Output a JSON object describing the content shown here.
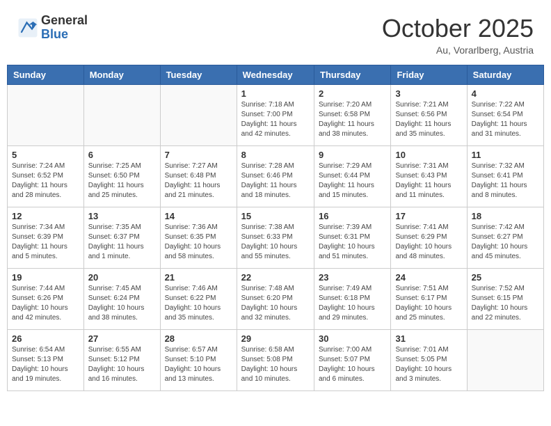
{
  "logo": {
    "general": "General",
    "blue": "Blue"
  },
  "title": {
    "month_year": "October 2025",
    "location": "Au, Vorarlberg, Austria"
  },
  "headers": [
    "Sunday",
    "Monday",
    "Tuesday",
    "Wednesday",
    "Thursday",
    "Friday",
    "Saturday"
  ],
  "weeks": [
    [
      {
        "day": "",
        "info": ""
      },
      {
        "day": "",
        "info": ""
      },
      {
        "day": "",
        "info": ""
      },
      {
        "day": "1",
        "info": "Sunrise: 7:18 AM\nSunset: 7:00 PM\nDaylight: 11 hours and 42 minutes."
      },
      {
        "day": "2",
        "info": "Sunrise: 7:20 AM\nSunset: 6:58 PM\nDaylight: 11 hours and 38 minutes."
      },
      {
        "day": "3",
        "info": "Sunrise: 7:21 AM\nSunset: 6:56 PM\nDaylight: 11 hours and 35 minutes."
      },
      {
        "day": "4",
        "info": "Sunrise: 7:22 AM\nSunset: 6:54 PM\nDaylight: 11 hours and 31 minutes."
      }
    ],
    [
      {
        "day": "5",
        "info": "Sunrise: 7:24 AM\nSunset: 6:52 PM\nDaylight: 11 hours and 28 minutes."
      },
      {
        "day": "6",
        "info": "Sunrise: 7:25 AM\nSunset: 6:50 PM\nDaylight: 11 hours and 25 minutes."
      },
      {
        "day": "7",
        "info": "Sunrise: 7:27 AM\nSunset: 6:48 PM\nDaylight: 11 hours and 21 minutes."
      },
      {
        "day": "8",
        "info": "Sunrise: 7:28 AM\nSunset: 6:46 PM\nDaylight: 11 hours and 18 minutes."
      },
      {
        "day": "9",
        "info": "Sunrise: 7:29 AM\nSunset: 6:44 PM\nDaylight: 11 hours and 15 minutes."
      },
      {
        "day": "10",
        "info": "Sunrise: 7:31 AM\nSunset: 6:43 PM\nDaylight: 11 hours and 11 minutes."
      },
      {
        "day": "11",
        "info": "Sunrise: 7:32 AM\nSunset: 6:41 PM\nDaylight: 11 hours and 8 minutes."
      }
    ],
    [
      {
        "day": "12",
        "info": "Sunrise: 7:34 AM\nSunset: 6:39 PM\nDaylight: 11 hours and 5 minutes."
      },
      {
        "day": "13",
        "info": "Sunrise: 7:35 AM\nSunset: 6:37 PM\nDaylight: 11 hours and 1 minute."
      },
      {
        "day": "14",
        "info": "Sunrise: 7:36 AM\nSunset: 6:35 PM\nDaylight: 10 hours and 58 minutes."
      },
      {
        "day": "15",
        "info": "Sunrise: 7:38 AM\nSunset: 6:33 PM\nDaylight: 10 hours and 55 minutes."
      },
      {
        "day": "16",
        "info": "Sunrise: 7:39 AM\nSunset: 6:31 PM\nDaylight: 10 hours and 51 minutes."
      },
      {
        "day": "17",
        "info": "Sunrise: 7:41 AM\nSunset: 6:29 PM\nDaylight: 10 hours and 48 minutes."
      },
      {
        "day": "18",
        "info": "Sunrise: 7:42 AM\nSunset: 6:27 PM\nDaylight: 10 hours and 45 minutes."
      }
    ],
    [
      {
        "day": "19",
        "info": "Sunrise: 7:44 AM\nSunset: 6:26 PM\nDaylight: 10 hours and 42 minutes."
      },
      {
        "day": "20",
        "info": "Sunrise: 7:45 AM\nSunset: 6:24 PM\nDaylight: 10 hours and 38 minutes."
      },
      {
        "day": "21",
        "info": "Sunrise: 7:46 AM\nSunset: 6:22 PM\nDaylight: 10 hours and 35 minutes."
      },
      {
        "day": "22",
        "info": "Sunrise: 7:48 AM\nSunset: 6:20 PM\nDaylight: 10 hours and 32 minutes."
      },
      {
        "day": "23",
        "info": "Sunrise: 7:49 AM\nSunset: 6:18 PM\nDaylight: 10 hours and 29 minutes."
      },
      {
        "day": "24",
        "info": "Sunrise: 7:51 AM\nSunset: 6:17 PM\nDaylight: 10 hours and 25 minutes."
      },
      {
        "day": "25",
        "info": "Sunrise: 7:52 AM\nSunset: 6:15 PM\nDaylight: 10 hours and 22 minutes."
      }
    ],
    [
      {
        "day": "26",
        "info": "Sunrise: 6:54 AM\nSunset: 5:13 PM\nDaylight: 10 hours and 19 minutes."
      },
      {
        "day": "27",
        "info": "Sunrise: 6:55 AM\nSunset: 5:12 PM\nDaylight: 10 hours and 16 minutes."
      },
      {
        "day": "28",
        "info": "Sunrise: 6:57 AM\nSunset: 5:10 PM\nDaylight: 10 hours and 13 minutes."
      },
      {
        "day": "29",
        "info": "Sunrise: 6:58 AM\nSunset: 5:08 PM\nDaylight: 10 hours and 10 minutes."
      },
      {
        "day": "30",
        "info": "Sunrise: 7:00 AM\nSunset: 5:07 PM\nDaylight: 10 hours and 6 minutes."
      },
      {
        "day": "31",
        "info": "Sunrise: 7:01 AM\nSunset: 5:05 PM\nDaylight: 10 hours and 3 minutes."
      },
      {
        "day": "",
        "info": ""
      }
    ]
  ]
}
